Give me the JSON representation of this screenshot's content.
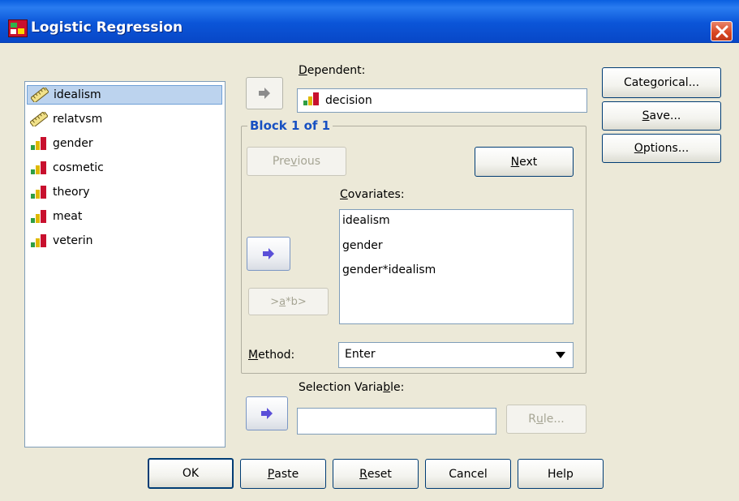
{
  "window": {
    "title": "Logistic Regression",
    "app_icon": "spss-dialog-icon",
    "close_icon": "close-icon"
  },
  "variables": [
    {
      "label": "idealism",
      "icon": "ruler-icon",
      "selected": true
    },
    {
      "label": "relatvsm",
      "icon": "ruler-icon",
      "selected": false
    },
    {
      "label": "gender",
      "icon": "bar-chart-icon",
      "selected": false
    },
    {
      "label": "cosmetic",
      "icon": "bar-chart-icon",
      "selected": false
    },
    {
      "label": "theory",
      "icon": "bar-chart-icon",
      "selected": false
    },
    {
      "label": "meat",
      "icon": "bar-chart-icon",
      "selected": false
    },
    {
      "label": "veterin",
      "icon": "bar-chart-icon",
      "selected": false
    }
  ],
  "dependent": {
    "label_pre": "",
    "label_u": "D",
    "label_post": "ependent:",
    "value": "decision"
  },
  "block": {
    "title": "Block 1 of 1",
    "previous_pre": "Pre",
    "previous_u": "v",
    "previous_post": "ious",
    "next_u": "N",
    "next_post": "ext"
  },
  "covariates": {
    "label_u": "C",
    "label_post": "ovariates:",
    "items": [
      "idealism",
      "gender",
      "gender*idealism"
    ],
    "interaction_pre": ">",
    "interaction_u": "a",
    "interaction_post": "*b>"
  },
  "method": {
    "label_u": "M",
    "label_post": "ethod:",
    "value": "Enter"
  },
  "selection_variable": {
    "label_pre": "Selection Varia",
    "label_u": "b",
    "label_post": "le:",
    "value": "",
    "rule_pre": "R",
    "rule_u": "u",
    "rule_post": "le..."
  },
  "side_buttons": {
    "categorical_pre": "Cate",
    "categorical_u": "g",
    "categorical_post": "orical...",
    "save_u": "S",
    "save_post": "ave...",
    "options_u": "O",
    "options_post": "ptions..."
  },
  "bottom_buttons": {
    "ok": "OK",
    "paste_u": "P",
    "paste_post": "aste",
    "reset_u": "R",
    "reset_post": "eset",
    "cancel": "Cancel",
    "help": "Help"
  },
  "colors": {
    "titlebar": "#0b55d8",
    "dialog_bg": "#ece9d8",
    "selected_row": "#bcd3ee",
    "group_title": "#1750c2",
    "arrow_active": "#5a4fd8",
    "arrow_disabled": "#8c8c8c"
  }
}
